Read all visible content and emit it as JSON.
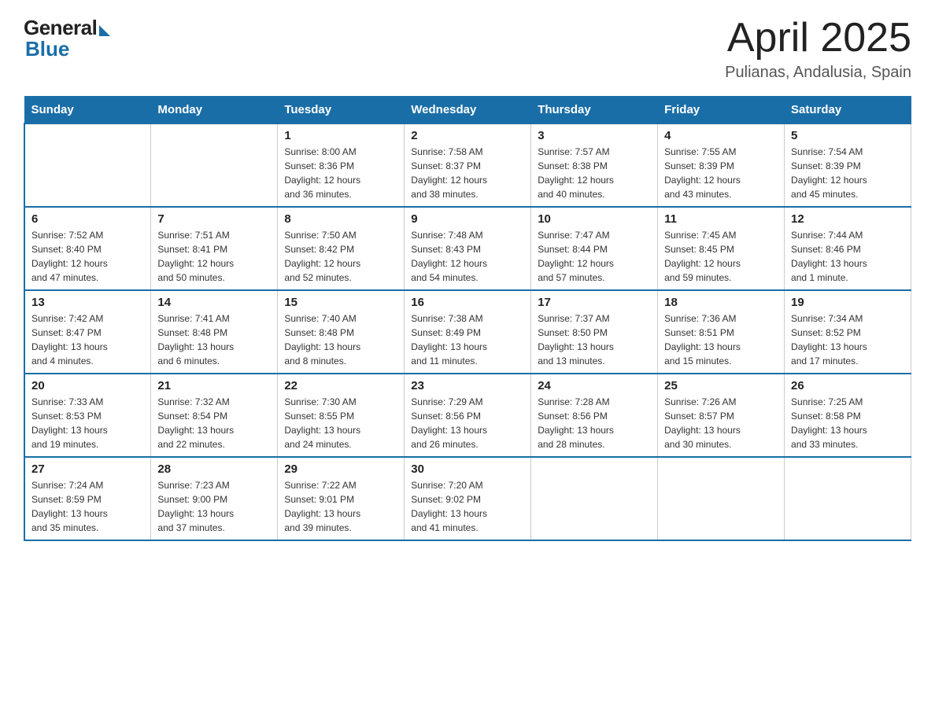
{
  "logo": {
    "general": "General",
    "blue": "Blue"
  },
  "header": {
    "month_year": "April 2025",
    "location": "Pulianas, Andalusia, Spain"
  },
  "days_of_week": [
    "Sunday",
    "Monday",
    "Tuesday",
    "Wednesday",
    "Thursday",
    "Friday",
    "Saturday"
  ],
  "weeks": [
    [
      {
        "day": "",
        "info": ""
      },
      {
        "day": "",
        "info": ""
      },
      {
        "day": "1",
        "info": "Sunrise: 8:00 AM\nSunset: 8:36 PM\nDaylight: 12 hours\nand 36 minutes."
      },
      {
        "day": "2",
        "info": "Sunrise: 7:58 AM\nSunset: 8:37 PM\nDaylight: 12 hours\nand 38 minutes."
      },
      {
        "day": "3",
        "info": "Sunrise: 7:57 AM\nSunset: 8:38 PM\nDaylight: 12 hours\nand 40 minutes."
      },
      {
        "day": "4",
        "info": "Sunrise: 7:55 AM\nSunset: 8:39 PM\nDaylight: 12 hours\nand 43 minutes."
      },
      {
        "day": "5",
        "info": "Sunrise: 7:54 AM\nSunset: 8:39 PM\nDaylight: 12 hours\nand 45 minutes."
      }
    ],
    [
      {
        "day": "6",
        "info": "Sunrise: 7:52 AM\nSunset: 8:40 PM\nDaylight: 12 hours\nand 47 minutes."
      },
      {
        "day": "7",
        "info": "Sunrise: 7:51 AM\nSunset: 8:41 PM\nDaylight: 12 hours\nand 50 minutes."
      },
      {
        "day": "8",
        "info": "Sunrise: 7:50 AM\nSunset: 8:42 PM\nDaylight: 12 hours\nand 52 minutes."
      },
      {
        "day": "9",
        "info": "Sunrise: 7:48 AM\nSunset: 8:43 PM\nDaylight: 12 hours\nand 54 minutes."
      },
      {
        "day": "10",
        "info": "Sunrise: 7:47 AM\nSunset: 8:44 PM\nDaylight: 12 hours\nand 57 minutes."
      },
      {
        "day": "11",
        "info": "Sunrise: 7:45 AM\nSunset: 8:45 PM\nDaylight: 12 hours\nand 59 minutes."
      },
      {
        "day": "12",
        "info": "Sunrise: 7:44 AM\nSunset: 8:46 PM\nDaylight: 13 hours\nand 1 minute."
      }
    ],
    [
      {
        "day": "13",
        "info": "Sunrise: 7:42 AM\nSunset: 8:47 PM\nDaylight: 13 hours\nand 4 minutes."
      },
      {
        "day": "14",
        "info": "Sunrise: 7:41 AM\nSunset: 8:48 PM\nDaylight: 13 hours\nand 6 minutes."
      },
      {
        "day": "15",
        "info": "Sunrise: 7:40 AM\nSunset: 8:48 PM\nDaylight: 13 hours\nand 8 minutes."
      },
      {
        "day": "16",
        "info": "Sunrise: 7:38 AM\nSunset: 8:49 PM\nDaylight: 13 hours\nand 11 minutes."
      },
      {
        "day": "17",
        "info": "Sunrise: 7:37 AM\nSunset: 8:50 PM\nDaylight: 13 hours\nand 13 minutes."
      },
      {
        "day": "18",
        "info": "Sunrise: 7:36 AM\nSunset: 8:51 PM\nDaylight: 13 hours\nand 15 minutes."
      },
      {
        "day": "19",
        "info": "Sunrise: 7:34 AM\nSunset: 8:52 PM\nDaylight: 13 hours\nand 17 minutes."
      }
    ],
    [
      {
        "day": "20",
        "info": "Sunrise: 7:33 AM\nSunset: 8:53 PM\nDaylight: 13 hours\nand 19 minutes."
      },
      {
        "day": "21",
        "info": "Sunrise: 7:32 AM\nSunset: 8:54 PM\nDaylight: 13 hours\nand 22 minutes."
      },
      {
        "day": "22",
        "info": "Sunrise: 7:30 AM\nSunset: 8:55 PM\nDaylight: 13 hours\nand 24 minutes."
      },
      {
        "day": "23",
        "info": "Sunrise: 7:29 AM\nSunset: 8:56 PM\nDaylight: 13 hours\nand 26 minutes."
      },
      {
        "day": "24",
        "info": "Sunrise: 7:28 AM\nSunset: 8:56 PM\nDaylight: 13 hours\nand 28 minutes."
      },
      {
        "day": "25",
        "info": "Sunrise: 7:26 AM\nSunset: 8:57 PM\nDaylight: 13 hours\nand 30 minutes."
      },
      {
        "day": "26",
        "info": "Sunrise: 7:25 AM\nSunset: 8:58 PM\nDaylight: 13 hours\nand 33 minutes."
      }
    ],
    [
      {
        "day": "27",
        "info": "Sunrise: 7:24 AM\nSunset: 8:59 PM\nDaylight: 13 hours\nand 35 minutes."
      },
      {
        "day": "28",
        "info": "Sunrise: 7:23 AM\nSunset: 9:00 PM\nDaylight: 13 hours\nand 37 minutes."
      },
      {
        "day": "29",
        "info": "Sunrise: 7:22 AM\nSunset: 9:01 PM\nDaylight: 13 hours\nand 39 minutes."
      },
      {
        "day": "30",
        "info": "Sunrise: 7:20 AM\nSunset: 9:02 PM\nDaylight: 13 hours\nand 41 minutes."
      },
      {
        "day": "",
        "info": ""
      },
      {
        "day": "",
        "info": ""
      },
      {
        "day": "",
        "info": ""
      }
    ]
  ]
}
